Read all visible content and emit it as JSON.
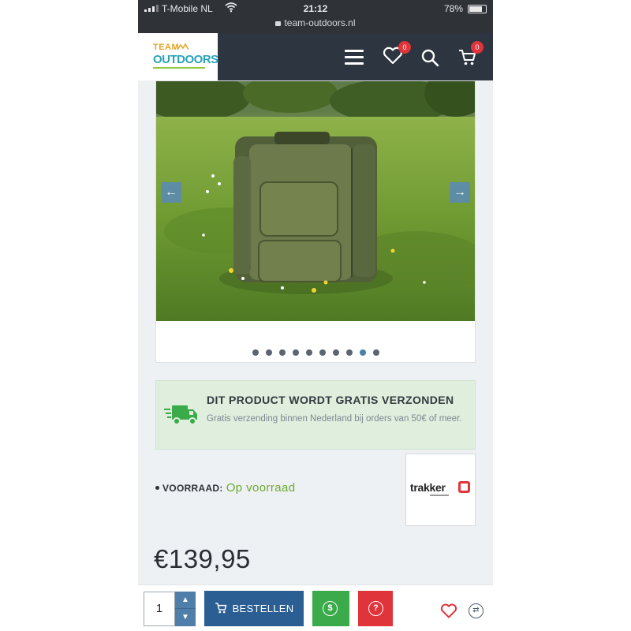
{
  "status_bar": {
    "carrier": "T-Mobile NL",
    "time": "21:12",
    "battery": "78%",
    "battery_level": 0.78
  },
  "url_bar": {
    "url": "team-outdoors.nl"
  },
  "header": {
    "logo_top": "TEAM",
    "logo_bottom": "OUTDOORS",
    "wishlist_count": "0",
    "cart_count": "0",
    "icons": [
      "menu-icon",
      "heart-icon",
      "search-icon",
      "cart-icon"
    ]
  },
  "gallery": {
    "prev_arrow": "←",
    "next_arrow": "→",
    "dot_count": 10,
    "active_dot": 8
  },
  "shipping": {
    "title": "DIT PRODUCT WORDT GRATIS VERZONDEN",
    "text": "Gratis verzending binnen Nederland bij orders van 50€ of meer.",
    "icon": "truck-icon"
  },
  "stock": {
    "label": "VOORRAAD:",
    "value": "Op voorraad"
  },
  "brand": {
    "name": "trakker"
  },
  "price": "€139,95",
  "bottom_bar": {
    "quantity": "1",
    "qty_up": "▲",
    "qty_down": "▼",
    "order_label": "BESTELLEN",
    "price_symbol": "$",
    "question_symbol": "?",
    "compare_symbol": "⇄"
  },
  "colors": {
    "header_bg": "#2d3540",
    "accent_blue": "#2b5e93",
    "stock_green": "#6aaa2e",
    "badge_red": "#e0343b",
    "shipping_bg": "#dfeedd"
  }
}
